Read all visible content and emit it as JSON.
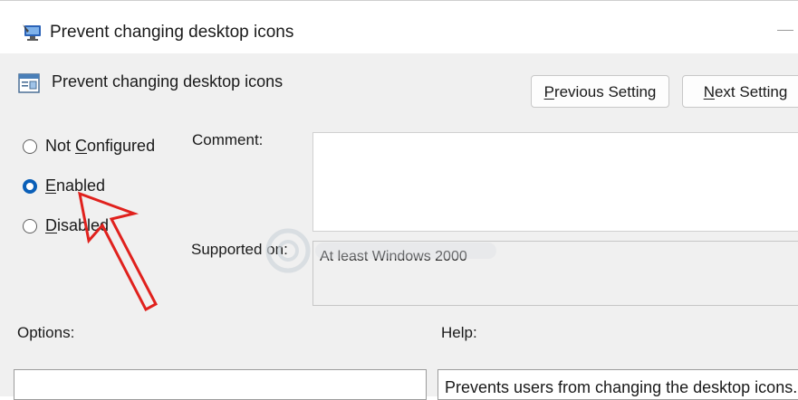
{
  "window": {
    "title": "Prevent changing desktop icons",
    "title_icon": "policy-window-icon"
  },
  "header": {
    "title": "Prevent changing desktop icons",
    "icon": "policy-setting-icon"
  },
  "buttons": {
    "previous": {
      "pre": "",
      "accel": "P",
      "post": "revious Setting"
    },
    "next": {
      "pre": "",
      "accel": "N",
      "post": "ext Setting"
    }
  },
  "state_options": [
    {
      "pre": "Not ",
      "accel": "C",
      "post": "onfigured",
      "checked": false
    },
    {
      "pre": "",
      "accel": "E",
      "post": "nabled",
      "checked": true
    },
    {
      "pre": "",
      "accel": "D",
      "post": "isabled",
      "checked": false
    }
  ],
  "comment": {
    "label": "Comment:",
    "value": ""
  },
  "supported_on": {
    "label": "Supported on:",
    "value": "At least Windows 2000"
  },
  "options": {
    "label": "Options:"
  },
  "help": {
    "label": "Help:",
    "text": "Prevents users from changing the desktop icons."
  },
  "colors": {
    "accent": "#0a5fb8",
    "annotation_arrow": "#e0211d"
  }
}
